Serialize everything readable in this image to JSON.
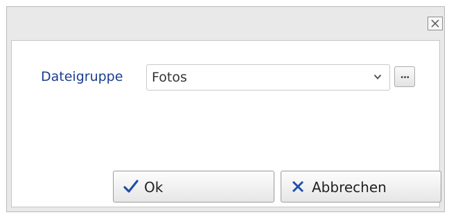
{
  "dialog": {
    "close_icon": "close-icon",
    "field_label": "Dateigruppe",
    "file_group": {
      "selected_value": "Fotos",
      "arrow_icon": "chevron-down-icon"
    },
    "more_button_label": "...",
    "ok_button": {
      "label": "Ok",
      "icon": "checkmark-icon",
      "icon_color": "#1f4fa8"
    },
    "cancel_button": {
      "label": "Abbrechen",
      "icon": "cross-icon",
      "icon_color": "#1f4fa8"
    }
  },
  "colors": {
    "label": "#1a3d8f",
    "accent_icons": "#1f4fa8",
    "titlebar": "#e9e9e9"
  }
}
